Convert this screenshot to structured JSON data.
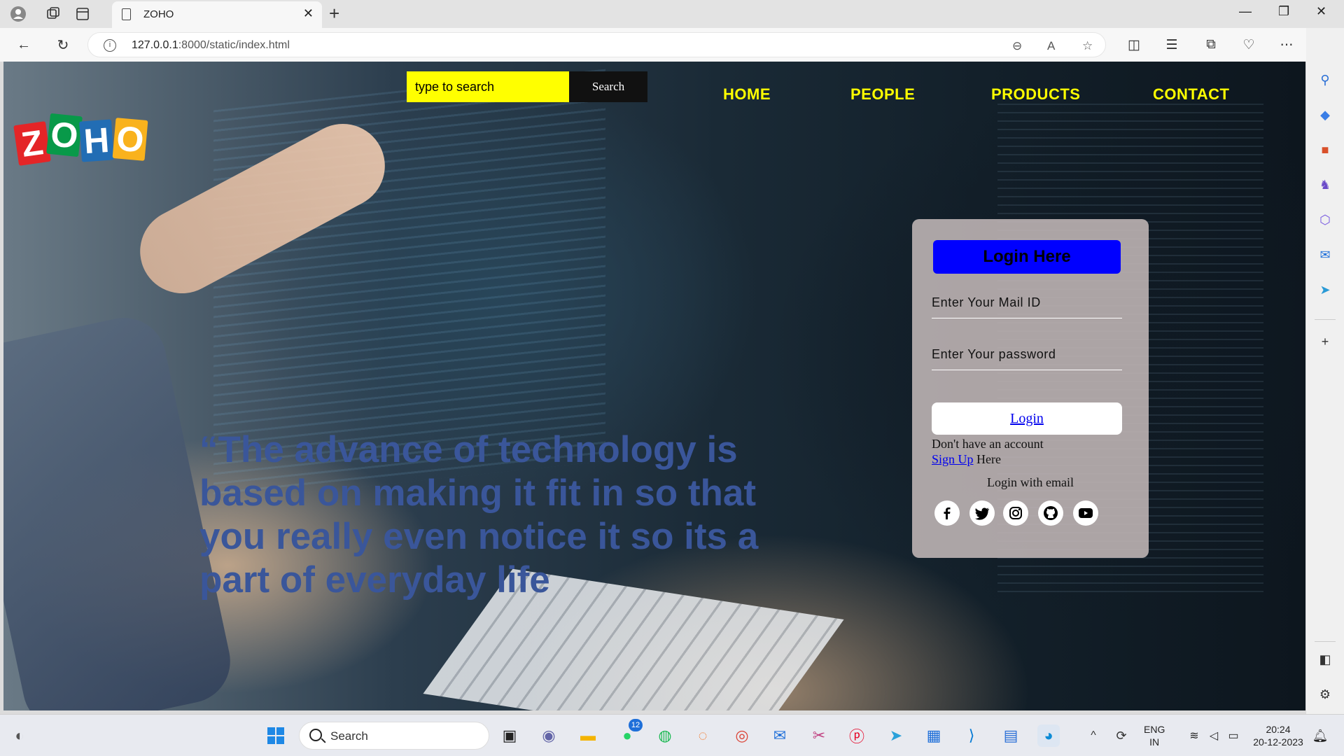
{
  "browser": {
    "tab_title": "ZOHO",
    "url_host": "127.0.0.1",
    "url_path": ":8000/static/index.html"
  },
  "page": {
    "logo_letters": [
      "Z",
      "O",
      "H",
      "O"
    ],
    "logo_colors": [
      "#e42527",
      "#089949",
      "#226db4",
      "#f9b21d"
    ],
    "search": {
      "placeholder": "type to search",
      "button": "Search"
    },
    "menu": [
      "HOME",
      "PEOPLE",
      "PRODUCTS",
      "CONTACT"
    ],
    "quote": "“The advance of technology is based on making it fit in so that you really even notice it so its a part of everyday life",
    "login": {
      "title": "Login Here",
      "email_placeholder": "Enter Your Mail ID",
      "password_placeholder": "Enter Your password",
      "login_button": "Login",
      "no_account": "Don't have an account",
      "signup_link": "Sign Up",
      "signup_suffix": "Here",
      "login_with": "Login with email",
      "social_icons": [
        "facebook-icon",
        "twitter-icon",
        "instagram-icon",
        "github-icon",
        "youtube-icon"
      ]
    },
    "colors": {
      "menu": "#ffff00",
      "search_bg": "#ffff00",
      "login_title_bg": "#0000ff",
      "quote": "#3a569a"
    }
  },
  "taskbar": {
    "search_label": "Search",
    "whatsapp_badge": "12",
    "lang": "ENG",
    "region": "IN",
    "time": "20:24",
    "date": "20-12-2023"
  }
}
